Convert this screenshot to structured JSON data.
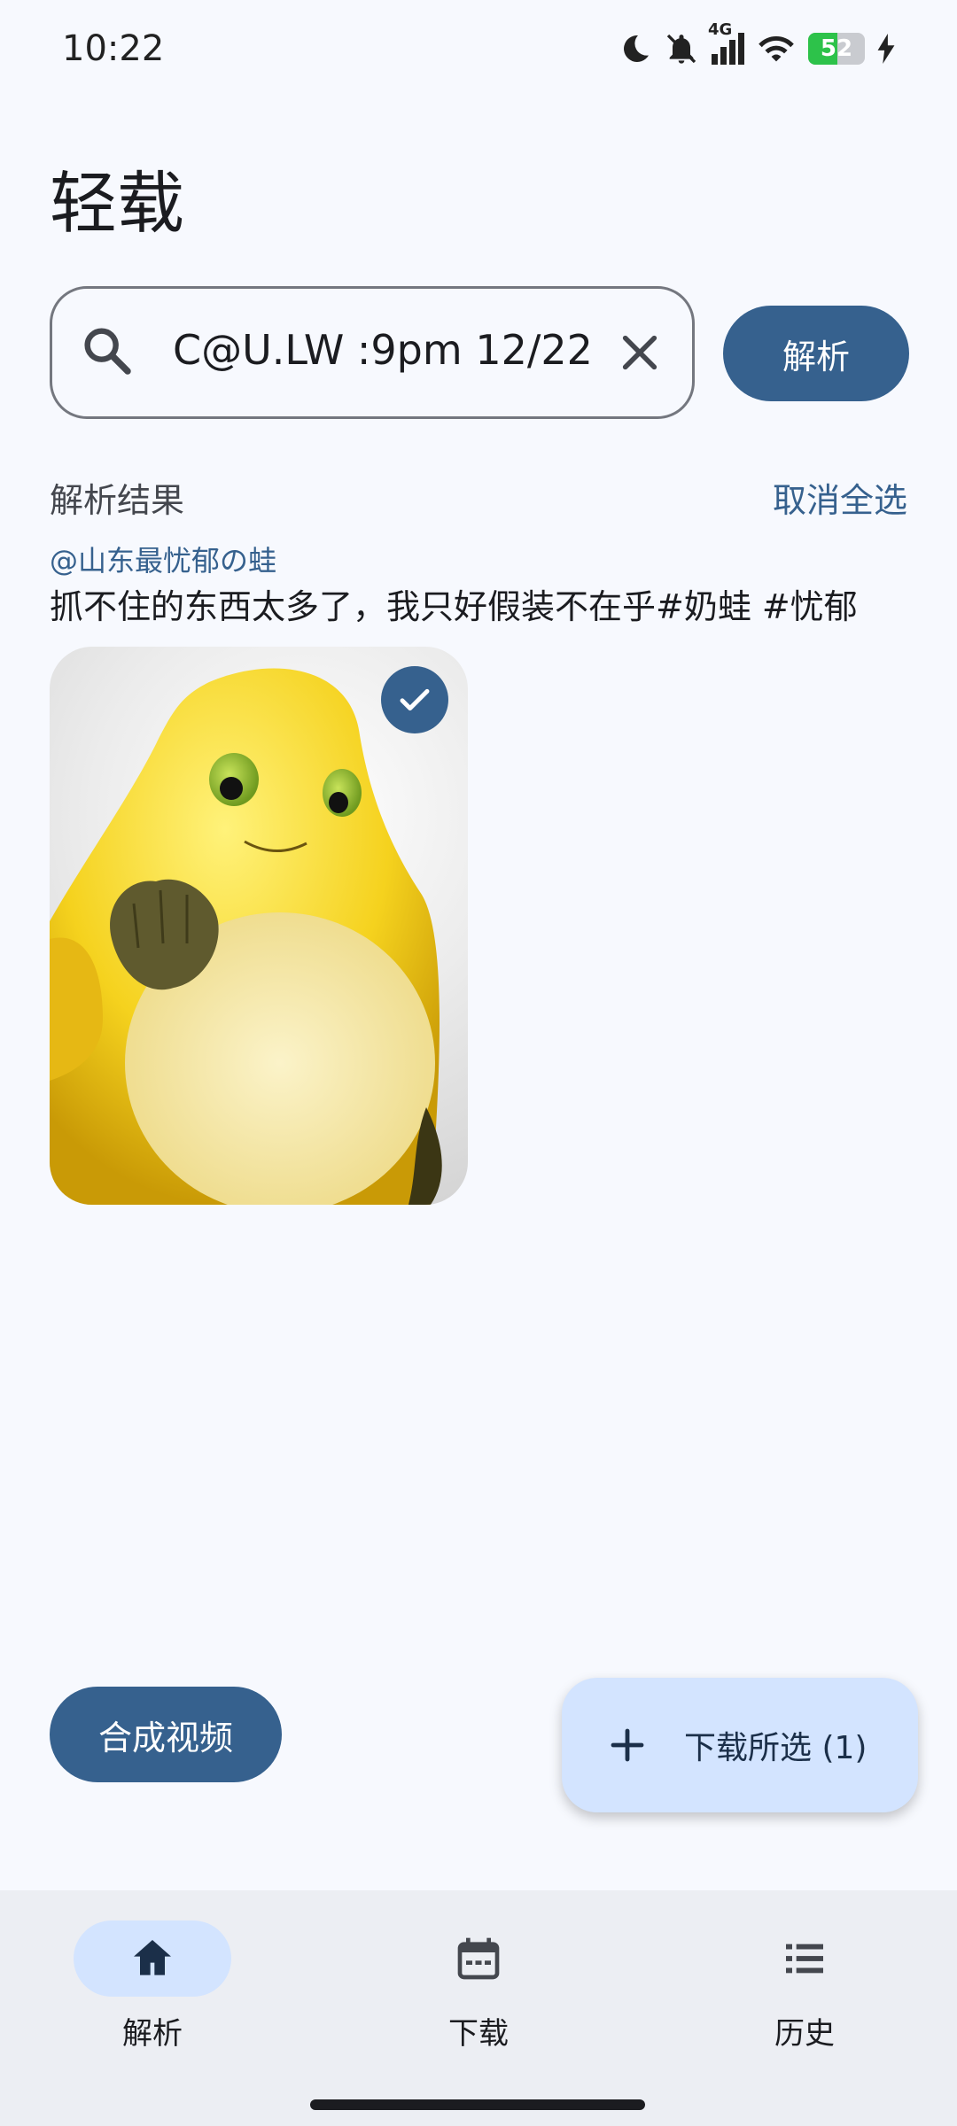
{
  "status_bar": {
    "time": "10:22",
    "network": "4G",
    "battery_level": "52",
    "colors": {
      "battery_fill": "#2dc24a"
    }
  },
  "app": {
    "title": "轻载",
    "accent_color": "#36618e"
  },
  "search": {
    "value": "C@U.LW :9pm 12/22",
    "icon": "search-icon",
    "clear_icon": "close-icon",
    "parse_label": "解析"
  },
  "results": {
    "label": "解析结果",
    "deselect_all": "取消全选",
    "author": "@山东最忧郁の蛙",
    "description": "抓不住的东西太多了，我只好假装不在乎#奶蛙 #忧郁",
    "media": [
      {
        "type": "image",
        "subject": "yellow frog figure",
        "selected": true
      }
    ]
  },
  "actions": {
    "compose_label": "合成视频",
    "download_selected_label": "下载所选 (1)"
  },
  "nav": {
    "items": [
      {
        "label": "解析",
        "icon": "home-icon",
        "active": true
      },
      {
        "label": "下载",
        "icon": "calendar-icon",
        "active": false
      },
      {
        "label": "历史",
        "icon": "list-icon",
        "active": false
      }
    ]
  }
}
